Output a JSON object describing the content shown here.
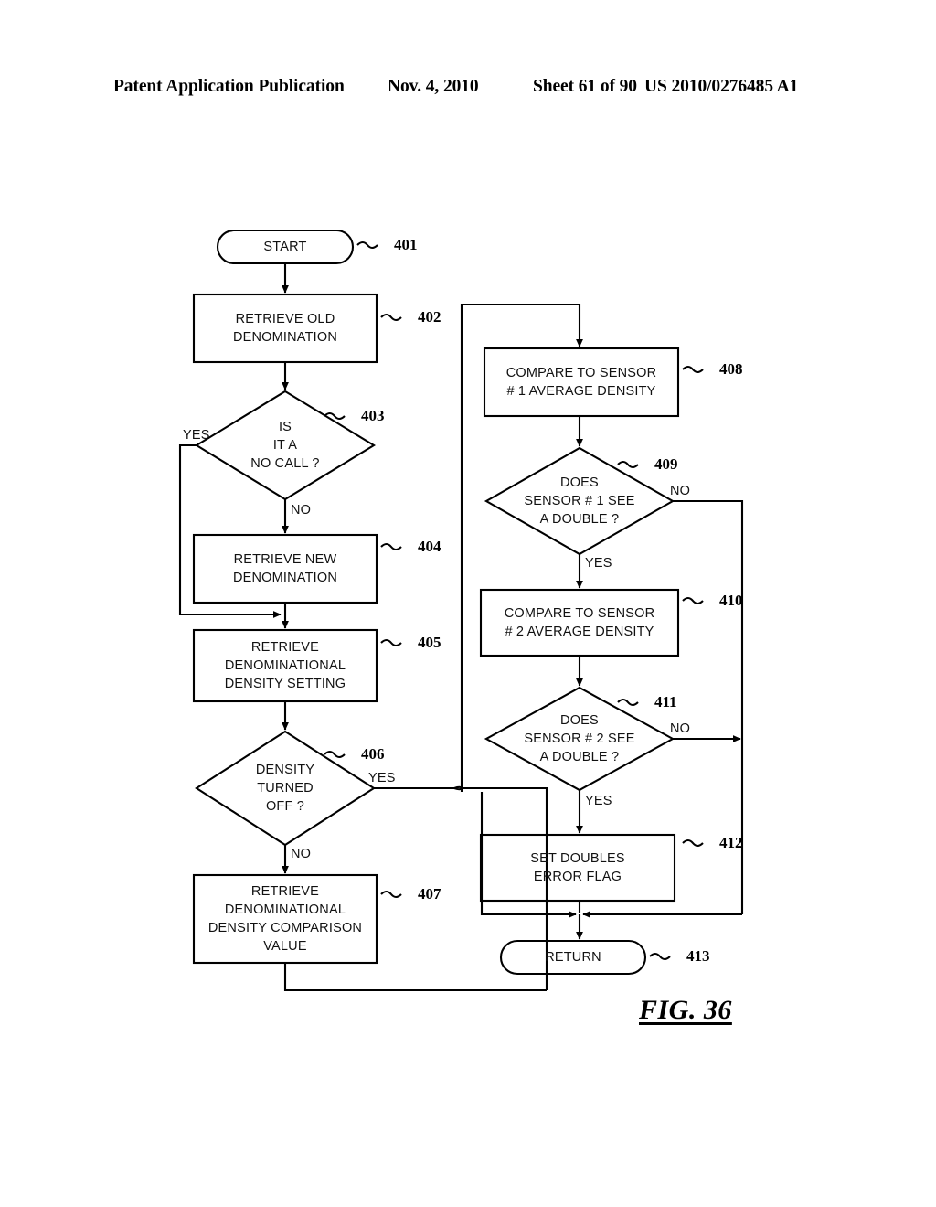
{
  "header": {
    "publication": "Patent Application Publication",
    "date": "Nov. 4, 2010",
    "sheet": "Sheet 61 of 90",
    "patent_number": "US 2010/0276485 A1"
  },
  "figure": {
    "caption": "FIG. 36",
    "nodes": [
      {
        "id": "401",
        "type": "terminator",
        "label": "START",
        "ref": "401"
      },
      {
        "id": "402",
        "type": "process",
        "label": "RETRIEVE OLD\nDENOMINATION",
        "ref": "402"
      },
      {
        "id": "403",
        "type": "decision",
        "label": "IS\nIT A\nNO CALL ?",
        "ref": "403"
      },
      {
        "id": "404",
        "type": "process",
        "label": "RETRIEVE NEW\nDENOMINATION",
        "ref": "404"
      },
      {
        "id": "405",
        "type": "process",
        "label": "RETRIEVE\nDENOMINATIONAL\nDENSITY SETTING",
        "ref": "405"
      },
      {
        "id": "406",
        "type": "decision",
        "label": "DENSITY\nTURNED\nOFF ?",
        "ref": "406"
      },
      {
        "id": "407",
        "type": "process",
        "label": "RETRIEVE\nDENOMINATIONAL\nDENSITY COMPARISON\nVALUE",
        "ref": "407"
      },
      {
        "id": "408",
        "type": "process",
        "label": "COMPARE TO SENSOR\n# 1 AVERAGE DENSITY",
        "ref": "408"
      },
      {
        "id": "409",
        "type": "decision",
        "label": "DOES\nSENSOR # 1 SEE\nA DOUBLE ?",
        "ref": "409"
      },
      {
        "id": "410",
        "type": "process",
        "label": "COMPARE TO SENSOR\n# 2 AVERAGE DENSITY",
        "ref": "410"
      },
      {
        "id": "411",
        "type": "decision",
        "label": "DOES\nSENSOR # 2 SEE\nA DOUBLE ?",
        "ref": "411"
      },
      {
        "id": "412",
        "type": "process",
        "label": "SET DOUBLES\nERROR FLAG",
        "ref": "412"
      },
      {
        "id": "413",
        "type": "terminator",
        "label": "RETURN",
        "ref": "413"
      }
    ],
    "edge_labels": [
      {
        "id": "e403-yes",
        "text": "YES",
        "from": "403"
      },
      {
        "id": "e403-no",
        "text": "NO",
        "from": "403"
      },
      {
        "id": "e406-yes",
        "text": "YES",
        "from": "406"
      },
      {
        "id": "e406-no",
        "text": "NO",
        "from": "406"
      },
      {
        "id": "e409-no",
        "text": "NO",
        "from": "409"
      },
      {
        "id": "e409-yes",
        "text": "YES",
        "from": "409"
      },
      {
        "id": "e411-no",
        "text": "NO",
        "from": "411"
      },
      {
        "id": "e411-yes",
        "text": "YES",
        "from": "411"
      }
    ],
    "colors": {
      "stroke": "#000000",
      "fill": "#ffffff",
      "background": "#ffffff"
    }
  }
}
